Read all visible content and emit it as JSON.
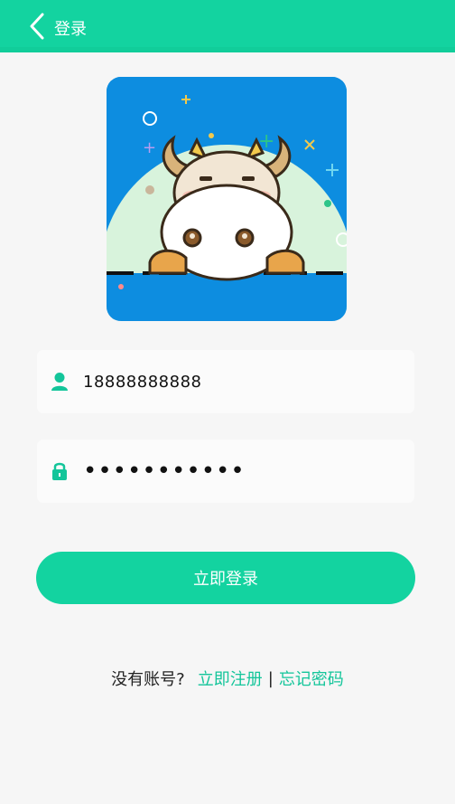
{
  "header": {
    "title": "登录",
    "back_icon": "chevron-left-icon",
    "bg_color": "#13d3a0"
  },
  "avatar": {
    "description_icon": "cow-mascot-illustration"
  },
  "form": {
    "phone": {
      "icon": "user-icon",
      "value": "18888888888"
    },
    "password": {
      "icon": "lock-icon",
      "value": "•••••••••••"
    }
  },
  "login_button": {
    "label": "立即登录",
    "color": "#13d3a0"
  },
  "footer": {
    "prompt": "没有账号?",
    "register_label": "立即注册",
    "separator": "|",
    "forgot_label": "忘记密码",
    "link_color": "#13c59a"
  }
}
